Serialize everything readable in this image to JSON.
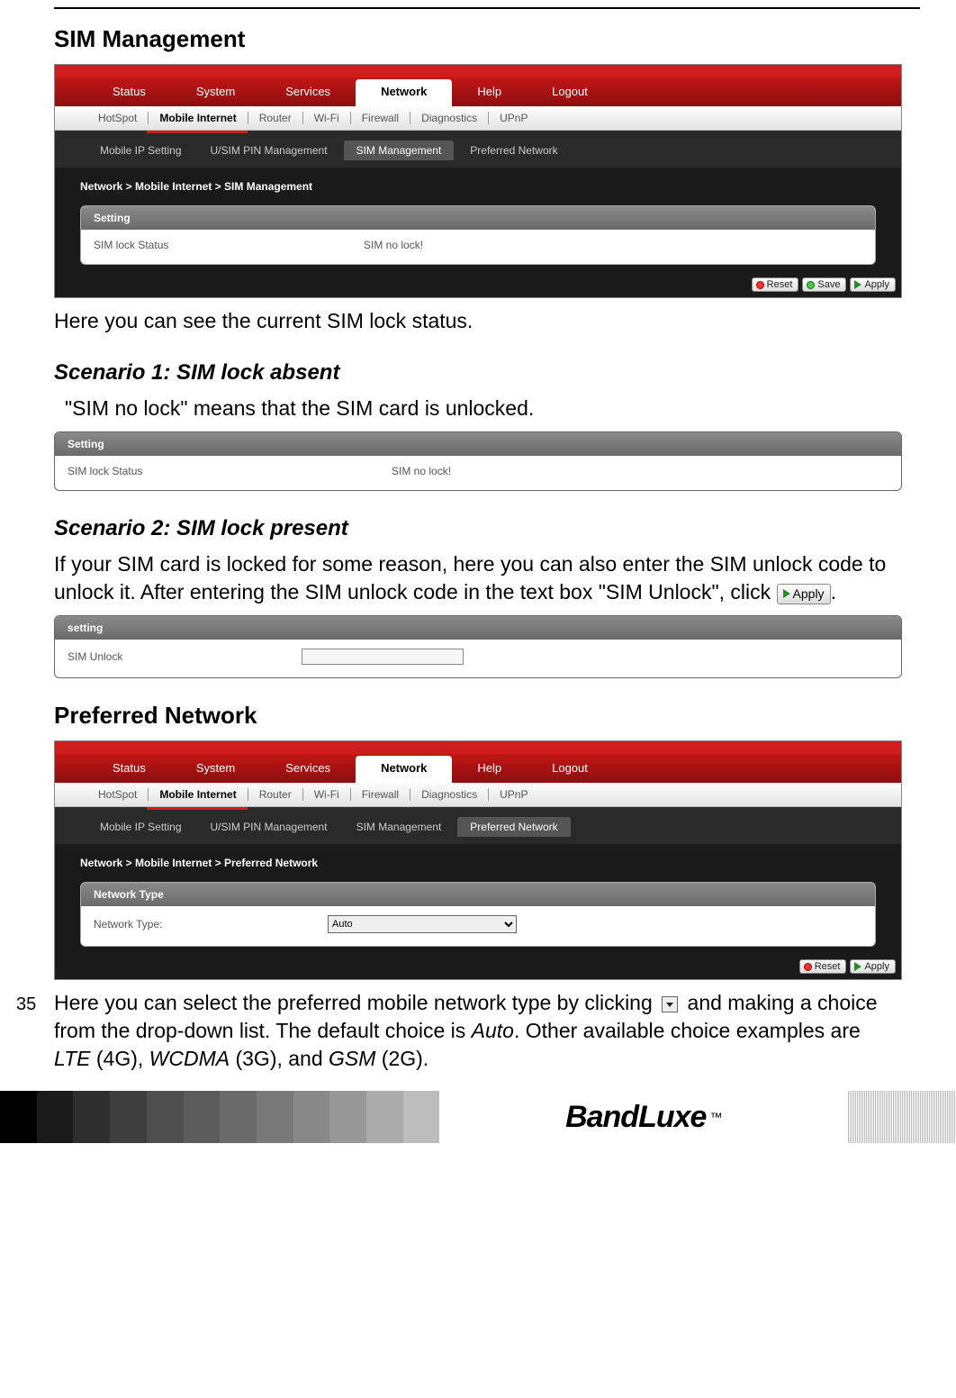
{
  "doc": {
    "section1_title": "SIM Management",
    "intro_text": "Here you can see the current SIM lock status.",
    "scenario1_title": "Scenario 1: SIM lock absent",
    "scenario1_text": "\"SIM no lock\" means that the SIM card is unlocked.",
    "scenario2_title": "Scenario 2: SIM lock present",
    "scenario2_text_a": "If your SIM card is locked for some reason, here you can also enter the SIM unlock code to unlock it. After entering the SIM unlock code in the text box \"SIM Unlock\", click ",
    "scenario2_text_b": ".",
    "section2_title": "Preferred Network",
    "preferred_text_a": "Here you can select the preferred mobile network type by clicking ",
    "preferred_text_b": " and making a choice from the drop-down list. The default choice is ",
    "preferred_text_c": ". Other available choice examples are ",
    "preferred_text_d": " (4G), ",
    "preferred_text_e": " (3G), and ",
    "preferred_text_f": " (2G).",
    "default_choice": "Auto",
    "choice_lte": "LTE",
    "choice_wcdma": "WCDMA",
    "choice_gsm": "GSM",
    "page_number": "35",
    "brand": "BandLuxe",
    "tm": "™"
  },
  "nav": {
    "main": [
      "Status",
      "System",
      "Services",
      "Network",
      "Help",
      "Logout"
    ],
    "main_active": "Network",
    "sub": [
      "HotSpot",
      "Mobile Internet",
      "Router",
      "Wi-Fi",
      "Firewall",
      "Diagnostics",
      "UPnP"
    ],
    "sub_active": "Mobile Internet",
    "tertiary": [
      "Mobile IP Setting",
      "U/SIM PIN Management",
      "SIM Management",
      "Preferred Network"
    ]
  },
  "shot1": {
    "tertiary_active": "SIM Management",
    "breadcrumb": "Network > Mobile Internet > SIM Management",
    "panel_header": "Setting",
    "row_label": "SIM lock Status",
    "row_value": "SIM no lock!",
    "buttons": {
      "reset": "Reset",
      "save": "Save",
      "apply": "Apply"
    }
  },
  "shot2": {
    "panel_header": "Setting",
    "row_label": "SIM lock Status",
    "row_value": "SIM no lock!"
  },
  "shot3": {
    "panel_header": "setting",
    "row_label": "SIM Unlock",
    "input_value": ""
  },
  "shot4": {
    "tertiary_active": "Preferred Network",
    "breadcrumb": "Network > Mobile Internet > Preferred Network",
    "panel_header": "Network Type",
    "row_label": "Network Type:",
    "select_value": "Auto",
    "buttons": {
      "reset": "Reset",
      "apply": "Apply"
    }
  },
  "inline": {
    "apply_label": "Apply"
  },
  "footer_shades": [
    "#000000",
    "#1a1a1a",
    "#2e2e2e",
    "#3e3e3e",
    "#4e4e4e",
    "#5c5c5c",
    "#6a6a6a",
    "#787878",
    "#888888",
    "#989898",
    "#aaaaaa",
    "#bcbcbc"
  ]
}
